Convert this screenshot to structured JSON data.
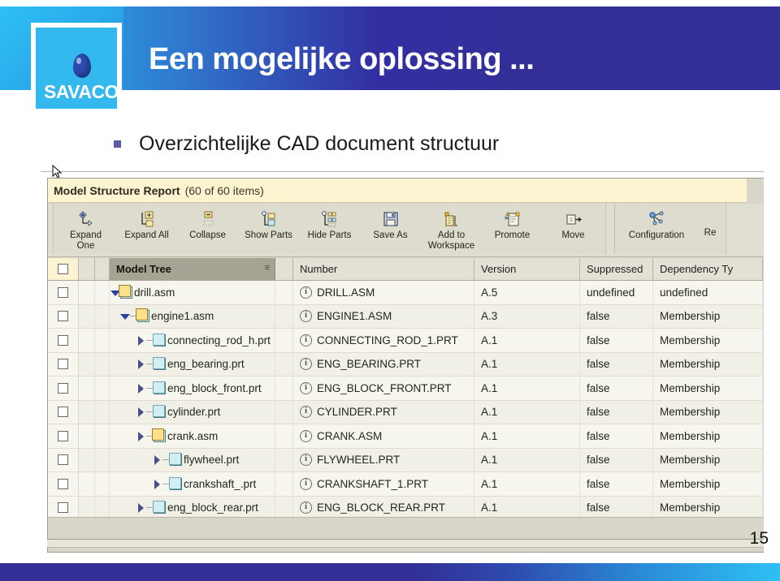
{
  "slide": {
    "title": "Een mogelijke oplossing ...",
    "bullet": "Overzichtelijke CAD document structuur",
    "page_number": "15",
    "logo_text": "SAVACO",
    "accent_blue": "#2fc0f5",
    "accent_navy": "#332f96"
  },
  "app": {
    "report_title": "Model Structure Report",
    "report_count": "(60 of 60 items)",
    "toolbar_groups": [
      {
        "buttons": [
          {
            "label": "Expand\nOne",
            "icon": "expand-one-icon"
          },
          {
            "label": "Expand All",
            "icon": "expand-all-icon"
          },
          {
            "label": "Collapse",
            "icon": "collapse-icon"
          },
          {
            "label": "Show Parts",
            "icon": "show-parts-icon"
          },
          {
            "label": "Hide Parts",
            "icon": "hide-parts-icon"
          },
          {
            "label": "Save As",
            "icon": "save-as-icon"
          },
          {
            "label": "Add to\nWorkspace",
            "icon": "add-to-workspace-icon"
          },
          {
            "label": "Promote",
            "icon": "promote-icon"
          },
          {
            "label": "Move",
            "icon": "move-icon"
          }
        ]
      },
      {
        "buttons": [
          {
            "label": "Configuration",
            "icon": "configuration-icon"
          },
          {
            "label": "Re",
            "icon": "report-icon"
          }
        ]
      }
    ],
    "table": {
      "columns": [
        {
          "key": "select",
          "label": ""
        },
        {
          "key": "tree",
          "label": "Model Tree"
        },
        {
          "key": "number",
          "label": "Number"
        },
        {
          "key": "version",
          "label": "Version"
        },
        {
          "key": "suppressed",
          "label": "Suppressed"
        },
        {
          "key": "dependency",
          "label": "Dependency Ty"
        }
      ],
      "rows": [
        {
          "name": "drill.asm",
          "depth": 0,
          "kind": "asm",
          "twisty": "down",
          "number": "DRILL.ASM",
          "version": "A.5",
          "suppressed": "undefined",
          "dependency": "undefined"
        },
        {
          "name": "engine1.asm",
          "depth": 1,
          "kind": "asm",
          "twisty": "down",
          "number": "ENGINE1.ASM",
          "version": "A.3",
          "suppressed": "false",
          "dependency": "Membership"
        },
        {
          "name": "connecting_rod_h.prt",
          "depth": 2,
          "kind": "prt",
          "twisty": "right",
          "number": "CONNECTING_ROD_1.PRT",
          "version": "A.1",
          "suppressed": "false",
          "dependency": "Membership"
        },
        {
          "name": "eng_bearing.prt",
          "depth": 2,
          "kind": "prt",
          "twisty": "right",
          "number": "ENG_BEARING.PRT",
          "version": "A.1",
          "suppressed": "false",
          "dependency": "Membership"
        },
        {
          "name": "eng_block_front.prt",
          "depth": 2,
          "kind": "prt",
          "twisty": "right",
          "number": "ENG_BLOCK_FRONT.PRT",
          "version": "A.1",
          "suppressed": "false",
          "dependency": "Membership"
        },
        {
          "name": "cylinder.prt",
          "depth": 2,
          "kind": "prt",
          "twisty": "right",
          "number": "CYLINDER.PRT",
          "version": "A.1",
          "suppressed": "false",
          "dependency": "Membership"
        },
        {
          "name": "crank.asm",
          "depth": 2,
          "kind": "asm",
          "twisty": "right",
          "number": "CRANK.ASM",
          "version": "A.1",
          "suppressed": "false",
          "dependency": "Membership"
        },
        {
          "name": "flywheel.prt",
          "depth": 3,
          "kind": "prt",
          "twisty": "right",
          "number": "FLYWHEEL.PRT",
          "version": "A.1",
          "suppressed": "false",
          "dependency": "Membership"
        },
        {
          "name": "crankshaft_.prt",
          "depth": 3,
          "kind": "prt",
          "twisty": "right",
          "number": "CRANKSHAFT_1.PRT",
          "version": "A.1",
          "suppressed": "false",
          "dependency": "Membership"
        },
        {
          "name": "eng_block_rear.prt",
          "depth": 2,
          "kind": "prt",
          "twisty": "right",
          "number": "ENG_BLOCK_REAR.PRT",
          "version": "A.1",
          "suppressed": "false",
          "dependency": "Membership"
        }
      ]
    }
  }
}
